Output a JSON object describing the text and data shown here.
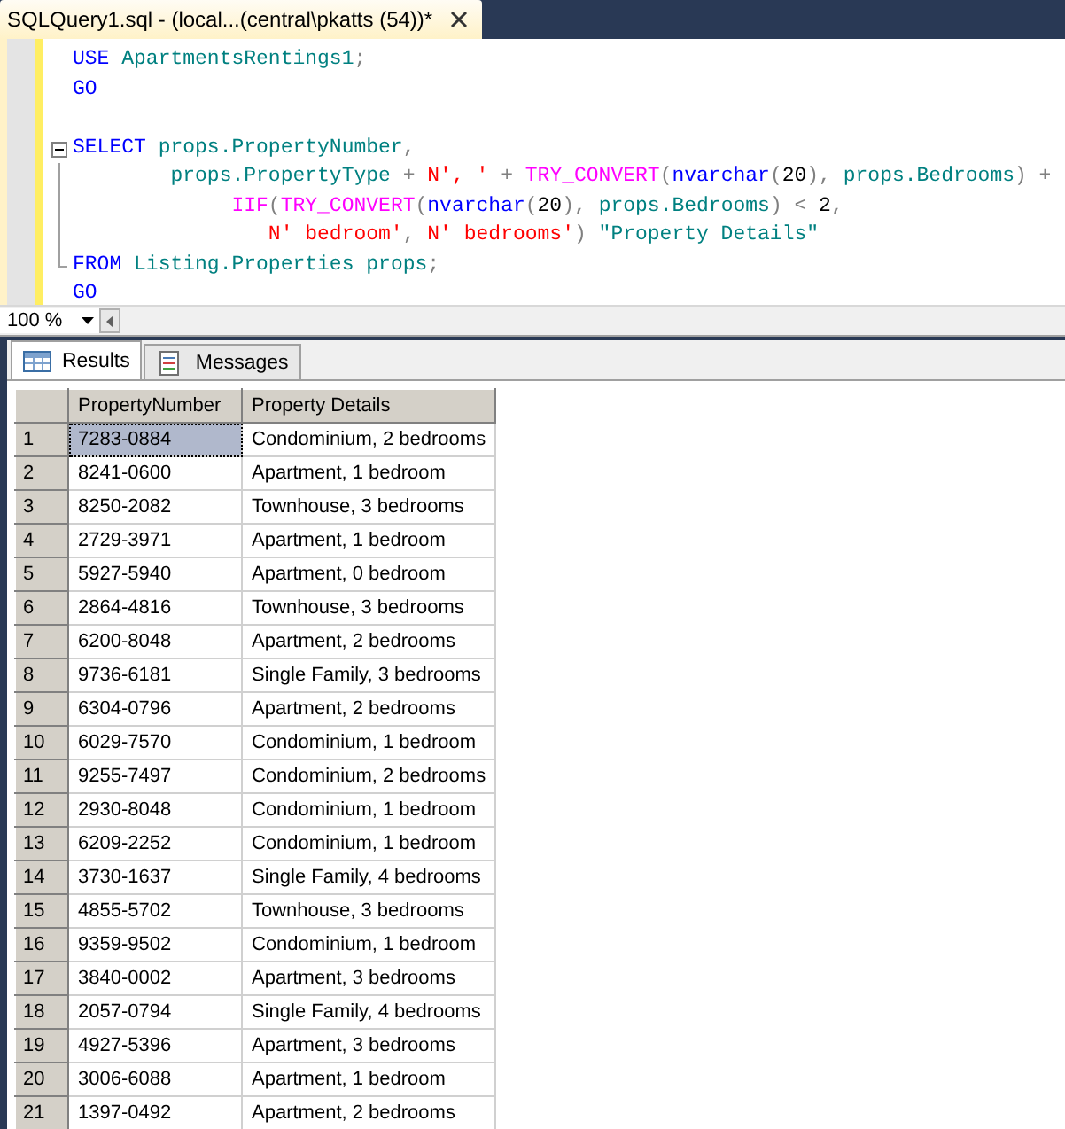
{
  "document_tab": {
    "title": "SQLQuery1.sql - (local...(central\\pkatts (54))*",
    "selected": true
  },
  "editor": {
    "lines": [
      {
        "in_fold": false,
        "tokens": [
          {
            "kind": "keyword",
            "text": "USE "
          },
          {
            "kind": "ident",
            "text": "ApartmentsRentings1"
          },
          {
            "kind": "operator",
            "text": ";"
          }
        ]
      },
      {
        "in_fold": false,
        "tokens": [
          {
            "kind": "keyword",
            "text": "GO"
          }
        ]
      },
      {
        "in_fold": false
      },
      {
        "fold": {
          "expanded": true
        },
        "tokens": [
          {
            "kind": "keyword",
            "text": "SELECT "
          },
          {
            "kind": "ident",
            "text": "props.PropertyNumber"
          },
          {
            "kind": "operator",
            "text": ","
          }
        ]
      },
      {
        "in_fold": true,
        "tokens": [
          {
            "kind": "ident",
            "text": "        props.PropertyType"
          },
          {
            "kind": "operator",
            "text": " + "
          },
          {
            "kind": "string",
            "text": "N', '"
          },
          {
            "kind": "operator",
            "text": " + "
          },
          {
            "kind": "function",
            "text": "TRY_CONVERT"
          },
          {
            "kind": "operator",
            "text": "("
          },
          {
            "kind": "keyword",
            "text": "nvarchar"
          },
          {
            "kind": "operator",
            "text": "("
          },
          {
            "kind": "plain",
            "text": "20"
          },
          {
            "kind": "operator",
            "text": "), "
          },
          {
            "kind": "ident",
            "text": "props.Bedrooms"
          },
          {
            "kind": "operator",
            "text": ") +"
          }
        ]
      },
      {
        "in_fold": true,
        "tokens": [
          {
            "kind": "function",
            "text": "             IIF"
          },
          {
            "kind": "operator",
            "text": "("
          },
          {
            "kind": "function",
            "text": "TRY_CONVERT"
          },
          {
            "kind": "operator",
            "text": "("
          },
          {
            "kind": "keyword",
            "text": "nvarchar"
          },
          {
            "kind": "operator",
            "text": "("
          },
          {
            "kind": "plain",
            "text": "20"
          },
          {
            "kind": "operator",
            "text": "), "
          },
          {
            "kind": "ident",
            "text": "props.Bedrooms"
          },
          {
            "kind": "operator",
            "text": ") < "
          },
          {
            "kind": "plain",
            "text": "2"
          },
          {
            "kind": "operator",
            "text": ","
          }
        ]
      },
      {
        "in_fold": true,
        "tokens": [
          {
            "kind": "string",
            "text": "                N' bedroom'"
          },
          {
            "kind": "operator",
            "text": ", "
          },
          {
            "kind": "string",
            "text": "N' bedrooms'"
          },
          {
            "kind": "operator",
            "text": ") "
          },
          {
            "kind": "ident",
            "text": "\"Property Details\""
          }
        ]
      },
      {
        "in_fold": true,
        "tokens": [
          {
            "kind": "keyword",
            "text": "FROM "
          },
          {
            "kind": "ident",
            "text": "Listing.Properties props"
          },
          {
            "kind": "operator",
            "text": ";"
          }
        ]
      },
      {
        "in_fold": false,
        "tokens": [
          {
            "kind": "keyword",
            "text": "GO"
          }
        ]
      }
    ]
  },
  "zoom": {
    "value": "100 %"
  },
  "result_tabs": [
    {
      "label": "Results",
      "kind": "grid",
      "selected": true
    },
    {
      "label": "Messages",
      "kind": "messages",
      "selected": false
    }
  ],
  "table": {
    "columns": [
      "PropertyNumber",
      "Property Details"
    ],
    "rows": [
      {
        "row": "1",
        "cells": [
          "7283-0884",
          "Condominium, 2 bedrooms"
        ],
        "selected": true
      },
      {
        "row": "2",
        "cells": [
          "8241-0600",
          "Apartment, 1 bedroom"
        ],
        "selected": false
      },
      {
        "row": "3",
        "cells": [
          "8250-2082",
          "Townhouse, 3 bedrooms"
        ],
        "selected": false
      },
      {
        "row": "4",
        "cells": [
          "2729-3971",
          "Apartment, 1 bedroom"
        ],
        "selected": false
      },
      {
        "row": "5",
        "cells": [
          "5927-5940",
          "Apartment, 0 bedroom"
        ],
        "selected": false
      },
      {
        "row": "6",
        "cells": [
          "2864-4816",
          "Townhouse, 3 bedrooms"
        ],
        "selected": false
      },
      {
        "row": "7",
        "cells": [
          "6200-8048",
          "Apartment, 2 bedrooms"
        ],
        "selected": false
      },
      {
        "row": "8",
        "cells": [
          "9736-6181",
          "Single Family, 3 bedrooms"
        ],
        "selected": false
      },
      {
        "row": "9",
        "cells": [
          "6304-0796",
          "Apartment, 2 bedrooms"
        ],
        "selected": false
      },
      {
        "row": "10",
        "cells": [
          "6029-7570",
          "Condominium, 1 bedroom"
        ],
        "selected": false
      },
      {
        "row": "11",
        "cells": [
          "9255-7497",
          "Condominium, 2 bedrooms"
        ],
        "selected": false
      },
      {
        "row": "12",
        "cells": [
          "2930-8048",
          "Condominium, 1 bedroom"
        ],
        "selected": false
      },
      {
        "row": "13",
        "cells": [
          "6209-2252",
          "Condominium, 1 bedroom"
        ],
        "selected": false
      },
      {
        "row": "14",
        "cells": [
          "3730-1637",
          "Single Family, 4 bedrooms"
        ],
        "selected": false
      },
      {
        "row": "15",
        "cells": [
          "4855-5702",
          "Townhouse, 3 bedrooms"
        ],
        "selected": false
      },
      {
        "row": "16",
        "cells": [
          "9359-9502",
          "Condominium, 1 bedroom"
        ],
        "selected": false
      },
      {
        "row": "17",
        "cells": [
          "3840-0002",
          "Apartment, 3 bedrooms"
        ],
        "selected": false
      },
      {
        "row": "18",
        "cells": [
          "2057-0794",
          "Single Family, 4 bedrooms"
        ],
        "selected": false
      },
      {
        "row": "19",
        "cells": [
          "4927-5396",
          "Apartment, 3 bedrooms"
        ],
        "selected": false
      },
      {
        "row": "20",
        "cells": [
          "3006-6088",
          "Apartment, 1 bedroom"
        ],
        "selected": false
      },
      {
        "row": "21",
        "cells": [
          "1397-0492",
          "Apartment, 2 bedrooms"
        ],
        "selected": false
      }
    ]
  }
}
